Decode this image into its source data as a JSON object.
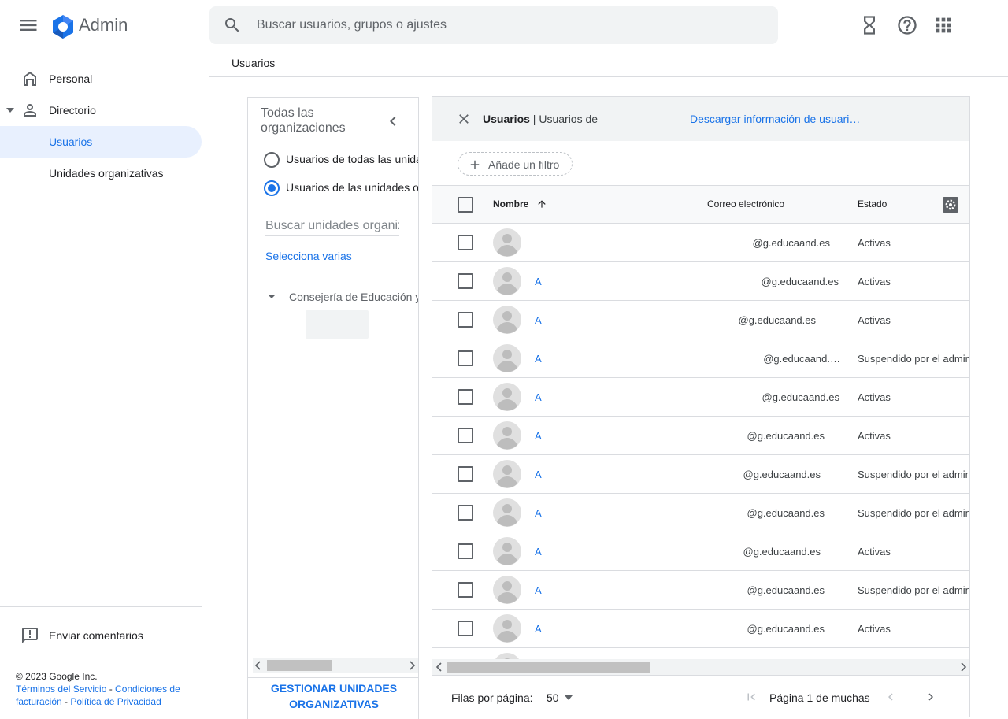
{
  "app": {
    "title": "Admin"
  },
  "search": {
    "placeholder": "Buscar usuarios, grupos o ajustes"
  },
  "sidebar": {
    "items": [
      {
        "label": "Personal"
      },
      {
        "label": "Directorio"
      },
      {
        "label": "Usuarios"
      },
      {
        "label": "Unidades organizativas"
      }
    ],
    "feedback": "Enviar comentarios",
    "footer": {
      "copyright": "© 2023 Google Inc.",
      "terms": "Términos del Servicio",
      "sep1": " - ",
      "billing_terms": "Condiciones de facturación",
      "sep2": " - ",
      "privacy": "Política de Privacidad"
    }
  },
  "breadcrumb": "Usuarios",
  "org_panel": {
    "title": "Todas las organizaciones",
    "option_all": "Usuarios de todas las unidades organizativas",
    "option_selected": "Usuarios de las unidades organizativas seleccionadas",
    "search_placeholder": "Buscar unidades organizativas",
    "select_multiple": "Selecciona varias",
    "tree_root": "Consejería de Educación y Deporte",
    "manage_button": "GESTIONAR UNIDADES ORGANIZATIVAS"
  },
  "users_panel": {
    "title": "Usuarios",
    "subtitle_sep": " | ",
    "subtitle": "Usuarios de",
    "download": "Descargar información de usuari…",
    "add_filter": "Añade un filtro",
    "columns": {
      "name": "Nombre",
      "email": "Correo electrónico",
      "status": "Estado"
    },
    "rows": [
      {
        "name": "",
        "email": "@g.educaand.es",
        "status": "Activas"
      },
      {
        "name": "A",
        "email": "@g.educaand.es",
        "status": "Activas"
      },
      {
        "name": "A",
        "email": "@g.educaand.es",
        "status": "Activas"
      },
      {
        "name": "A",
        "email": "@g.educaand.…",
        "status": "Suspendido por el administrador"
      },
      {
        "name": "A",
        "email": "@g.educaand.es",
        "status": "Activas"
      },
      {
        "name": "A",
        "email": "@g.educaand.es",
        "status": "Activas"
      },
      {
        "name": "A",
        "email": "@g.educaand.es",
        "status": "Suspendido por el administrador"
      },
      {
        "name": "A",
        "email": "@g.educaand.es",
        "status": "Suspendido por el administrador"
      },
      {
        "name": "A",
        "email": "@g.educaand.es",
        "status": "Activas"
      },
      {
        "name": "A",
        "email": "@g.educaand.es",
        "status": "Suspendido por el administrador"
      },
      {
        "name": "A",
        "email": "@g.educaand.es",
        "status": "Activas"
      }
    ],
    "rows_per_page_label": "Filas por página:",
    "rows_per_page": "50",
    "page_info": "Página 1 de muchas"
  },
  "colors": {
    "accent": "#1a73e8",
    "selected_bg": "#e8f0fe",
    "header_bg": "#f1f3f4"
  },
  "icons": [
    "menu-icon",
    "admin-logo-icon",
    "search-icon",
    "hourglass-icon",
    "help-icon",
    "apps-icon",
    "home-icon",
    "person-icon",
    "feedback-icon",
    "chevron-left-icon",
    "close-icon",
    "plus-icon",
    "arrow-up-icon",
    "gear-icon",
    "avatar-icon",
    "first-page-icon",
    "chevron-right-icon"
  ]
}
